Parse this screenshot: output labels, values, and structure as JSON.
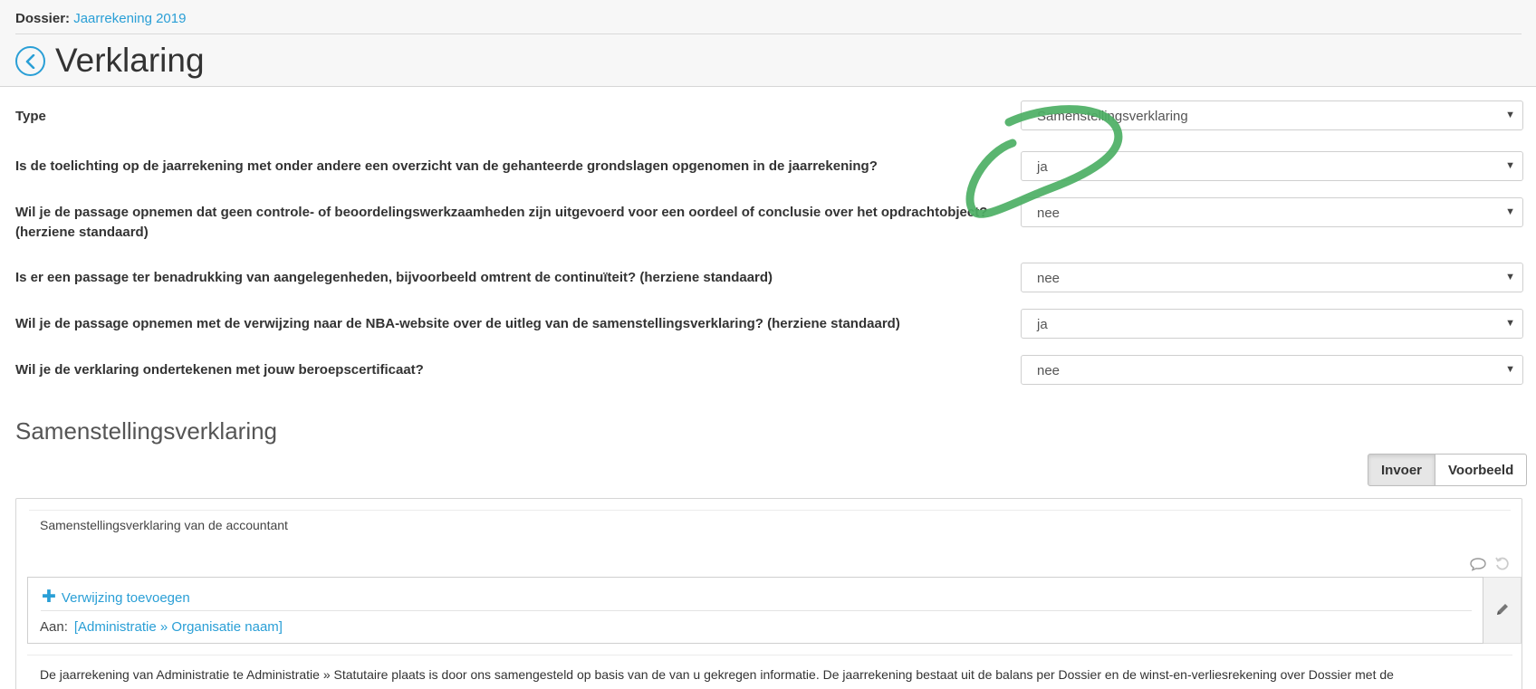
{
  "header": {
    "dossier_label": "Dossier:",
    "dossier_link": "Jaarrekening 2019",
    "title": "Verklaring",
    "back_icon": "chevron-left-icon"
  },
  "form": {
    "type_label": "Type",
    "type_value": "Samenstellingsverklaring",
    "questions": [
      {
        "label": "Is de toelichting op de jaarrekening met onder andere een overzicht van de gehanteerde grondslagen opgenomen in de jaarrekening?",
        "value": "ja"
      },
      {
        "label": "Wil je de passage opnemen dat geen controle- of beoordelingswerkzaamheden zijn uitgevoerd voor een oordeel of conclusie over het opdrachtobject? (herziene standaard)",
        "value": "nee"
      },
      {
        "label": "Is er een passage ter benadrukking van aangelegenheden, bijvoorbeeld omtrent de continuïteit? (herziene standaard)",
        "value": "nee"
      },
      {
        "label": "Wil je de passage opnemen met de verwijzing naar de NBA-website over de uitleg van de samenstellingsverklaring? (herziene standaard)",
        "value": "ja"
      },
      {
        "label": "Wil je de verklaring ondertekenen met jouw beroepscertificaat?",
        "value": "nee"
      }
    ],
    "caret_glyph": "▼"
  },
  "section": {
    "title": "Samenstellingsverklaring",
    "buttons": {
      "input": "Invoer",
      "preview": "Voorbeeld"
    }
  },
  "panel": {
    "heading": "Samenstellingsverklaring van de accountant",
    "add_reference": "Verwijzing toevoegen",
    "add_plus": "✚",
    "to_label": "Aan:",
    "to_link": "[Administratie » Organisatie naam]",
    "paragraph": "De jaarrekening van  Administratie  te  Administratie » Statutaire plaats  is door ons samengesteld op basis van de van u gekregen informatie. De jaarrekening bestaat uit de balans per  Dossier  en de winst-en-verliesrekening over  Dossier  met de",
    "icons": [
      "comment-icon",
      "undo-icon",
      "pencil-icon"
    ]
  },
  "colors": {
    "link": "#2a9fd6",
    "annotation": "#4caf64"
  }
}
